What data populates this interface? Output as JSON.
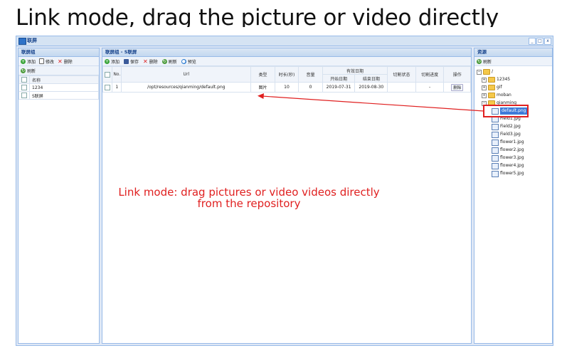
{
  "heading": "Link mode, drag the picture or video directly",
  "window": {
    "title": "联屏",
    "buttons": [
      "_",
      "□",
      "x"
    ]
  },
  "left_panel": {
    "title": "联屏组",
    "toolbar": {
      "add": "添加",
      "edit": "修改",
      "delete": "删除",
      "refresh": "刷新"
    },
    "column": "名称",
    "rows": [
      "1234",
      "S联屏"
    ]
  },
  "center_panel": {
    "title": "联屏组 - S联屏",
    "toolbar": {
      "add": "添加",
      "save": "保存",
      "delete": "删除",
      "refresh": "刷新",
      "preview": "预览"
    },
    "headers": {
      "no": "No.",
      "url": "Url",
      "type": "类型",
      "duration": "时长(秒)",
      "volume": "音量",
      "valid_date": "有效日期",
      "start_date": "开始日期",
      "end_date": "结束日期",
      "switch_state": "切割状态",
      "switch_progress": "切割进度",
      "action": "操作"
    },
    "rows": [
      {
        "no": "1",
        "url": "/opt/resources/qianming/default.png",
        "type": "图片",
        "duration": "10",
        "volume": "0",
        "start": "2019-07-31",
        "end": "2019-08-30",
        "state": "",
        "progress": "-",
        "action": "删除"
      }
    ]
  },
  "right_panel": {
    "title": "资源",
    "refresh": "刷新",
    "tree": {
      "root": "/",
      "folders": [
        "12345",
        "gif",
        "moban",
        "qianming"
      ],
      "files": [
        "default.png",
        "Field1.jpg",
        "Field2.jpg",
        "Field3.jpg",
        "flower1.jpg",
        "flower2.jpg",
        "flower3.jpg",
        "flower4.jpg",
        "flower5.jpg"
      ]
    }
  },
  "annotation": {
    "line1": "Link mode: drag pictures or video videos directly",
    "line2": "from the repository",
    "color": "#e02020"
  }
}
